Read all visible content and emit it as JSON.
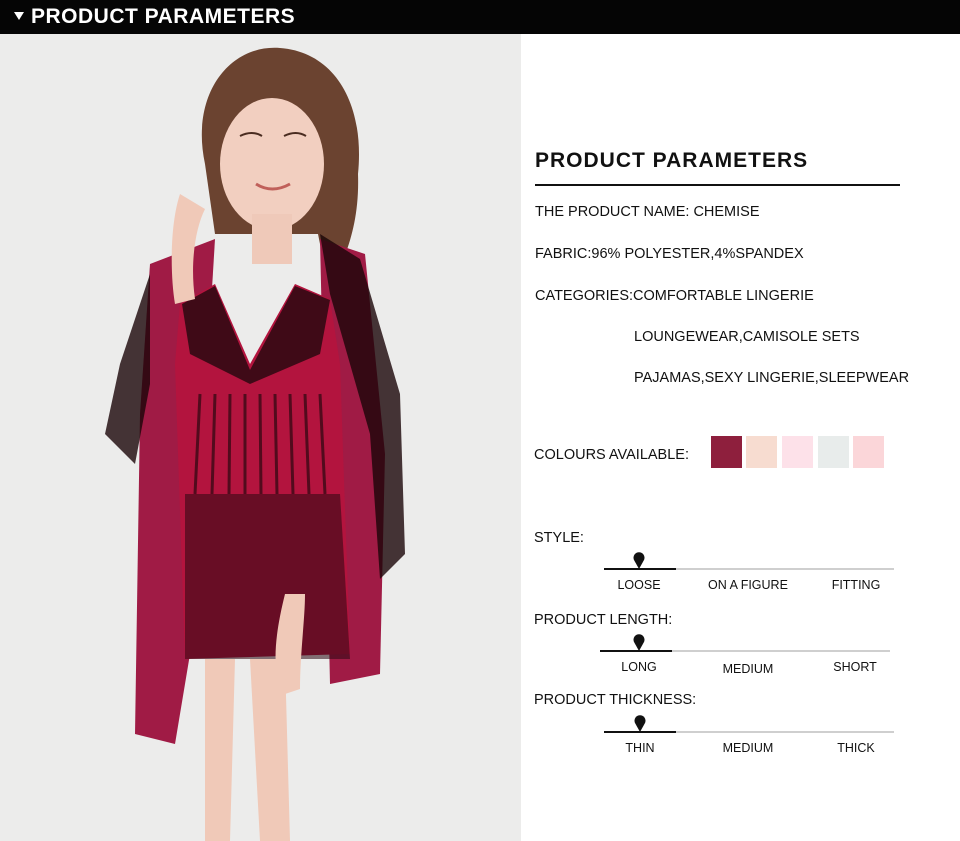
{
  "header": {
    "title": "PRODUCT PARAMETERS"
  },
  "section": {
    "title": "PRODUCT PARAMETERS",
    "product_name": "THE PRODUCT NAME: CHEMISE",
    "fabric": "FABRIC:96% POLYESTER,4%SPANDEX",
    "categories": [
      "CATEGORIES:COMFORTABLE LINGERIE",
      "LOUNGEWEAR,CAMISOLE SETS",
      "PAJAMAS,SEXY LINGERIE,SLEEPWEAR"
    ]
  },
  "colours": {
    "label": "COLOURS AVAILABLE:",
    "swatches": [
      "#8e1f3d",
      "#f7dcd0",
      "#fde1e9",
      "#e8eceb",
      "#fbd6d9"
    ]
  },
  "scales": [
    {
      "label": "STYLE:",
      "options": [
        "LOOSE",
        "ON A FIGURE",
        "FITTING"
      ],
      "selected": "LOOSE"
    },
    {
      "label": "PRODUCT LENGTH:",
      "options": [
        "LONG",
        "MEDIUM",
        "SHORT"
      ],
      "selected": "LONG"
    },
    {
      "label": "PRODUCT THICKNESS:",
      "options": [
        "THIN",
        "MEDIUM",
        "THICK"
      ],
      "selected": "THIN"
    }
  ]
}
